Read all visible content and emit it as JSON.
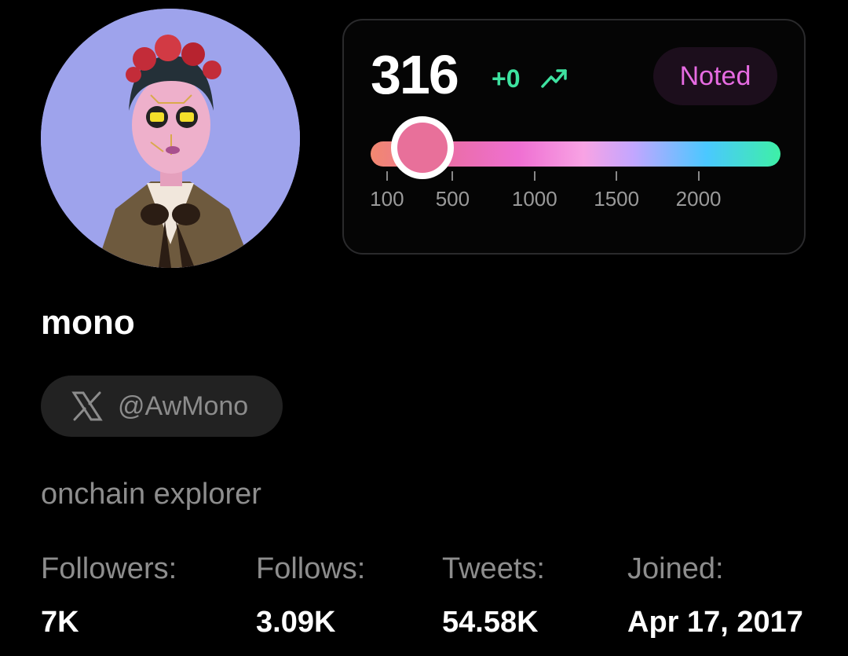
{
  "profile": {
    "name": "mono",
    "handle": "@AwMono",
    "bio": "onchain explorer",
    "avatar_icon": "cyberpunk-portrait-avatar"
  },
  "score": {
    "value": "316",
    "delta": "+0",
    "trend_icon": "trend-up-icon",
    "status": "Noted",
    "slider_value": 316,
    "slider_min": 0,
    "slider_max": 2500,
    "ticks": [
      "100",
      "500",
      "1000",
      "1500",
      "2000"
    ],
    "colors": {
      "delta": "#3ee2a0",
      "status_text": "#e66be2",
      "thumb": "#e8709a"
    }
  },
  "stats": [
    {
      "label": "Followers:",
      "value": "7K"
    },
    {
      "label": "Follows:",
      "value": "3.09K"
    },
    {
      "label": "Tweets:",
      "value": "54.58K"
    },
    {
      "label": "Joined:",
      "value": "Apr 17, 2017"
    }
  ]
}
